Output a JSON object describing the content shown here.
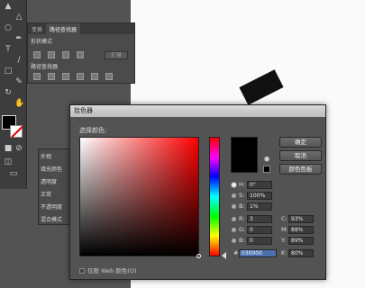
{
  "pathfinder": {
    "tabs": [
      "变换",
      "路径查找器"
    ],
    "shape_mode_label": "形状模式",
    "pathfinders_label": "路径查找器",
    "expand_label": "扩展"
  },
  "appearance": {
    "title": "外观",
    "rows": [
      "填充颜色",
      "透明度",
      "正常",
      "不透明度",
      "混合模式"
    ]
  },
  "color_picker": {
    "title": "拾色器",
    "select_label": "选择颜色:",
    "buttons": {
      "ok": "确定",
      "cancel": "取消",
      "swatches": "颜色色板"
    },
    "hsb": {
      "h_label": "H:",
      "h": "0°",
      "s_label": "S:",
      "s": "100%",
      "b_label": "B:",
      "b": "1%"
    },
    "rgb": {
      "r_label": "R:",
      "r": "3",
      "g_label": "G:",
      "g": "0",
      "b_label": "B:",
      "b": "0"
    },
    "cmyk": {
      "c_label": "C:",
      "c": "93%",
      "m_label": "M:",
      "m": "88%",
      "y_label": "Y:",
      "y": "89%",
      "k_label": "K:",
      "k": "80%"
    },
    "hex_prefix": "#",
    "hex": "030000",
    "websafe_label": "仅限 Web 颜色(O)"
  },
  "colors": {
    "current_color": "#000000",
    "hue": "#ff0000"
  }
}
